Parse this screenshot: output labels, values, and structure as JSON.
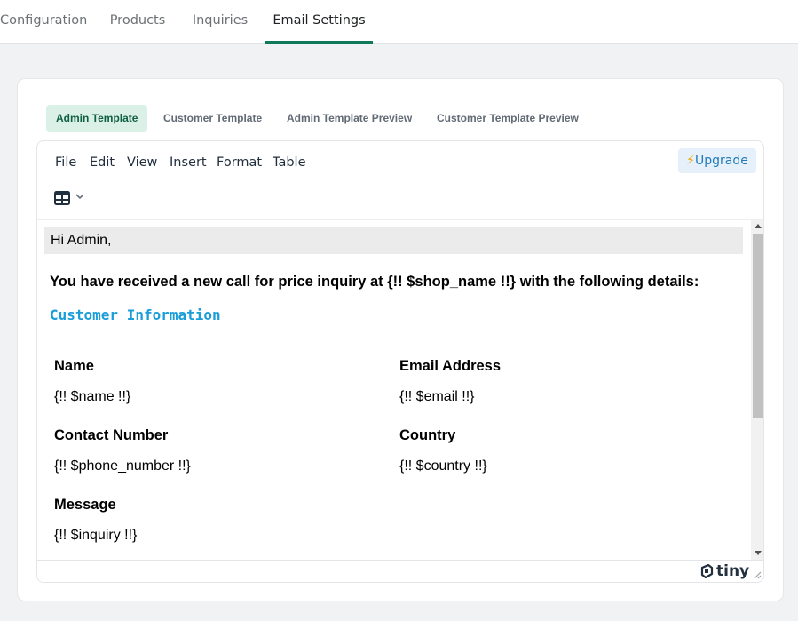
{
  "topnav": {
    "tabs": [
      {
        "label": "Configuration"
      },
      {
        "label": "Products"
      },
      {
        "label": "Inquiries"
      },
      {
        "label": "Email Settings"
      }
    ],
    "active_tab": "Email Settings",
    "accent_color": "#0f7a5a"
  },
  "subtabs": [
    {
      "label": "Admin Template"
    },
    {
      "label": "Customer Template"
    },
    {
      "label": "Admin Template Preview"
    },
    {
      "label": "Customer Template Preview"
    }
  ],
  "editor": {
    "menu": [
      "File",
      "Edit",
      "View",
      "Insert",
      "Format",
      "Table"
    ],
    "upgrade_label": "Upgrade",
    "upgrade_icon": "lightning-bolt-icon",
    "toolbar_icon": "table-icon",
    "brand": "tiny",
    "content": {
      "greeting": "Hi Admin,",
      "intro": "You have received a new call for price inquiry at {!! $shop_name !!} with the following details:",
      "section_title": "Customer Information",
      "section_color": "#1a9dd9",
      "fields": [
        {
          "label": "Name",
          "value": "{!! $name !!}"
        },
        {
          "label": "Email Address",
          "value": "{!! $email !!}"
        },
        {
          "label": "Contact Number",
          "value": "{!! $phone_number !!}"
        },
        {
          "label": "Country",
          "value": "{!! $country !!}"
        },
        {
          "label": "Message",
          "value": "{!! $inquiry !!}"
        }
      ]
    }
  }
}
